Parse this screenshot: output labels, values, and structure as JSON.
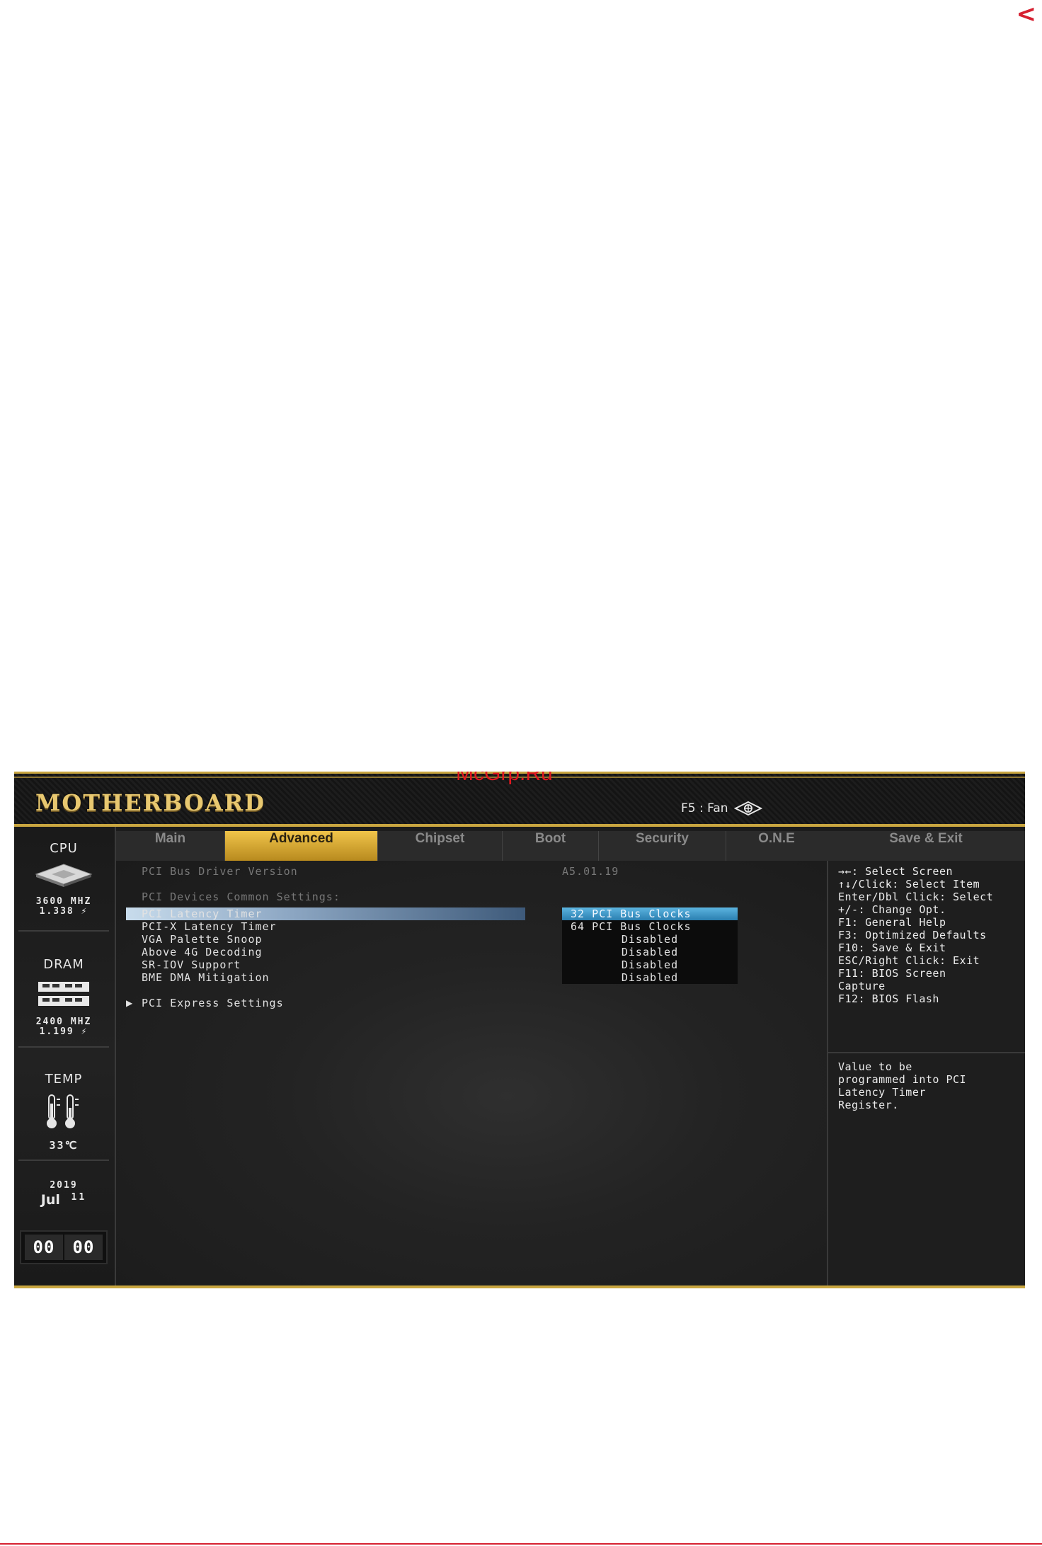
{
  "page": {
    "nav_arrow": "<"
  },
  "header": {
    "brand": "MOTHERBOARD",
    "watermark": "McGrp.Ru",
    "fan_label": "F5 : Fan"
  },
  "sidebar": {
    "cpu": {
      "title": "CPU",
      "freq": "3600 MHZ",
      "volt": "1.338 ⚡"
    },
    "dram": {
      "title": "DRAM",
      "freq": "2400 MHZ",
      "volt": "1.199 ⚡"
    },
    "temp": {
      "title": "TEMP",
      "value": "33℃"
    },
    "date": {
      "year": "2019",
      "month": "Jul",
      "day": "11"
    },
    "clock": {
      "hours": "00",
      "minutes": "00"
    }
  },
  "tabs": [
    "Main",
    "Advanced",
    "Chipset",
    "Boot",
    "Security",
    "O.N.E"
  ],
  "active_tab": "Advanced",
  "save_exit": "Save & Exit",
  "main": {
    "driver_label": "PCI Bus Driver Version",
    "driver_value": "A5.01.19",
    "common_header": "PCI Devices Common Settings:",
    "settings": [
      {
        "label": "PCI Latency Timer",
        "value": "32 PCI Bus Clocks"
      },
      {
        "label": "PCI-X Latency Timer",
        "value": "64 PCI Bus Clocks"
      },
      {
        "label": "VGA Palette Snoop",
        "value": "Disabled"
      },
      {
        "label": "Above 4G Decoding",
        "value": "Disabled"
      },
      {
        "label": "SR-IOV Support",
        "value": "Disabled"
      },
      {
        "label": "BME DMA Mitigation",
        "value": "Disabled"
      }
    ],
    "submenu": "PCI Express Settings"
  },
  "help": {
    "keys": [
      "→←: Select Screen",
      "↑↓/Click: Select Item",
      "Enter/Dbl Click: Select",
      "+/-: Change Opt.",
      "F1: General Help",
      "F3: Optimized Defaults",
      "F10: Save & Exit",
      "ESC/Right Click: Exit",
      "F11: BIOS Screen",
      "Capture",
      "F12: BIOS Flash"
    ],
    "description": [
      "Value to be",
      "programmed into PCI",
      "Latency Timer",
      "Register."
    ]
  },
  "colors": {
    "accent_gold": "#c9a640",
    "highlight_blue": "#2a7fb0",
    "watermark_red": "#e01820"
  }
}
